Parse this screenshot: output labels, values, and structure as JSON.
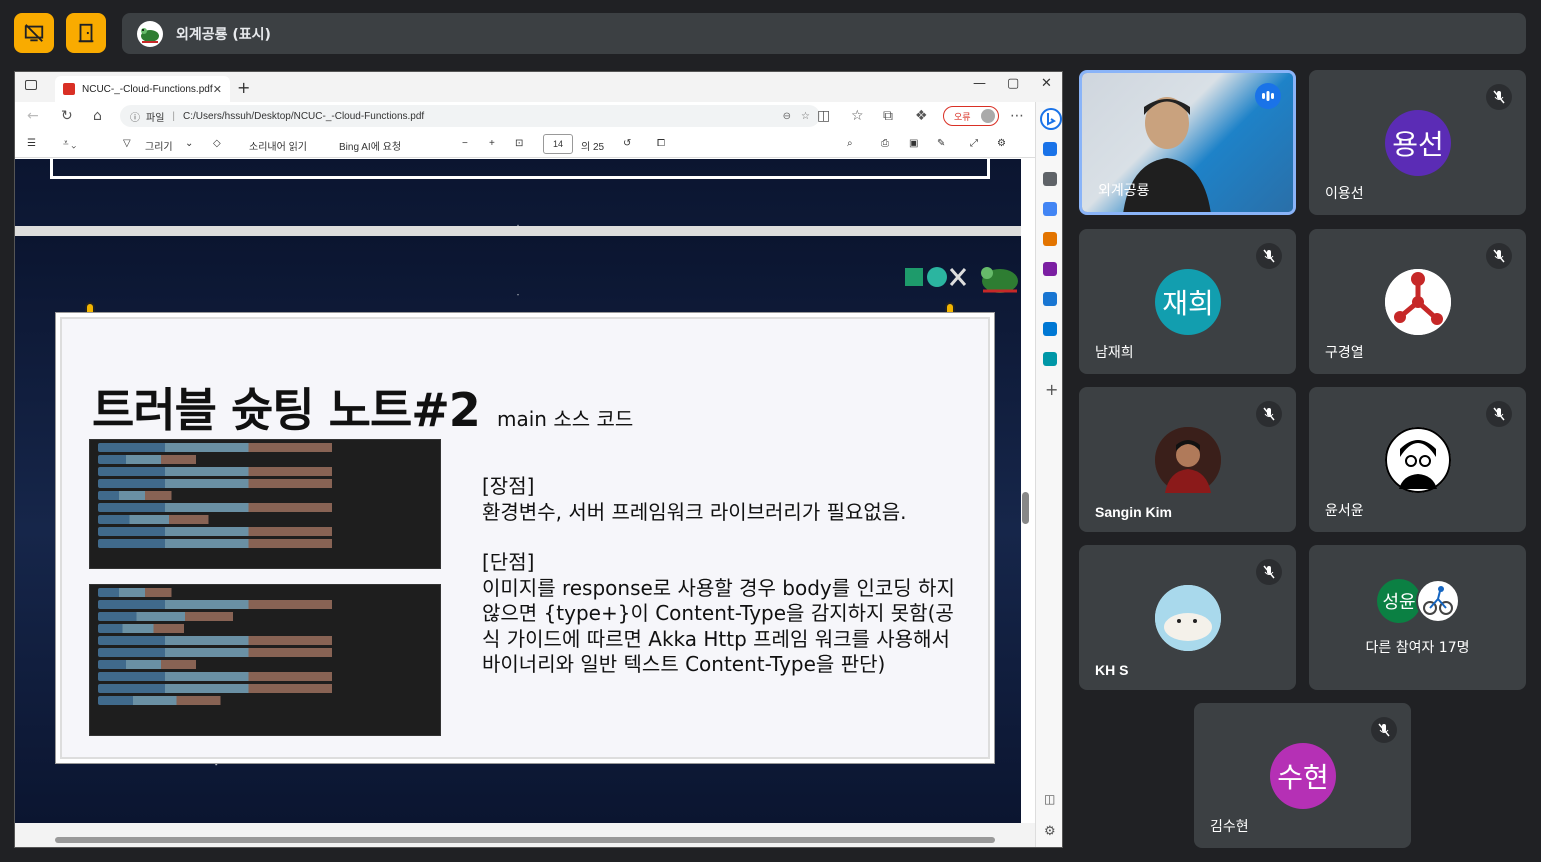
{
  "meeting": {
    "presenting_label": "외계공룡 (표시)"
  },
  "browser": {
    "tab_title": "NCUC-_-Cloud-Functions.pdf",
    "url_prefix": "파일",
    "url": "C:/Users/hssuh/Desktop/NCUC-_-Cloud-Functions.pdf",
    "error_badge": "오류"
  },
  "pdf_toolbar": {
    "draw": "그리기",
    "read_aloud": "소리내어 읽기",
    "bing": "Bing AI에 요청",
    "page": "14",
    "total": "의 25"
  },
  "slide": {
    "title": "트러블 슛팅 노트#2",
    "subtitle": "main 소스 코드",
    "pros_head": "[장점]",
    "pros_body": "환경변수, 서버 프레임워크 라이브러리가 필요없음.",
    "cons_head": "[단점]",
    "cons_body": "이미지를 response로 사용할 경우 body를 인코딩 하지 않으면 {type+}이 Content-Type을 감지하지 못함(공식 가이드에 따르면 Akka Http 프레임 워크를 사용해서 바이너리와 일반 텍스트 Content-Type을 판단)"
  },
  "participants": [
    {
      "name": "외계공룡",
      "state": "speaking"
    },
    {
      "name": "이용선",
      "initials": "용선",
      "color": "#5b2cb5"
    },
    {
      "name": "남재희",
      "initials": "재희",
      "color": "#129eaf"
    },
    {
      "name": "구경열"
    },
    {
      "name": "Sangin Kim"
    },
    {
      "name": "윤서윤"
    },
    {
      "name": "KH S"
    },
    {
      "name": "김수현",
      "initials": "수현",
      "color": "#b530b5"
    }
  ],
  "others": {
    "initials": "성윤",
    "label": "다른 참여자 17명"
  }
}
